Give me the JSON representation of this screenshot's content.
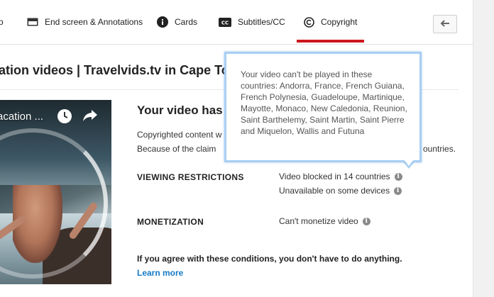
{
  "tabs": [
    {
      "label": "o",
      "icon": "none"
    },
    {
      "label": "End screen & Annotations",
      "icon": "end-screen-icon"
    },
    {
      "label": "Cards",
      "icon": "info-icon"
    },
    {
      "label": "Subtitles/CC",
      "icon": "cc-icon"
    },
    {
      "label": "Copyright",
      "icon": "copyright-icon",
      "active": true
    }
  ],
  "video": {
    "title": "ation videos | Travelvids.tv in Cape Town",
    "thumbnail_title": "acation ..."
  },
  "content": {
    "headline": "Your video has",
    "body_line1": "Copyrighted content w",
    "body_line2": "Because of the claim",
    "body_line2_tail": "ountries.",
    "viewing_label": "VIEWING RESTRICTIONS",
    "viewing_value1": "Video blocked in 14 countries",
    "viewing_value2": "Unavailable on some devices",
    "monetization_label": "MONETIZATION",
    "monetization_value": "Can't monetize video",
    "agree_text": "If you agree with these conditions, you don't have to do anything.",
    "learn_more": "Learn more"
  },
  "tooltip": {
    "text": "Your video can't be played in these countries: Andorra, France, French Guiana, French Polynesia, Guadeloupe, Martinique, Mayotte, Monaco, New Caledonia, Reunion, Saint Barthelemy, Saint Martin, Saint Pierre and Miquelon, Wallis and Futuna"
  },
  "colors": {
    "active_tab": "#cc181e",
    "link": "#167ac6",
    "tooltip_border": "#a9cff3"
  }
}
